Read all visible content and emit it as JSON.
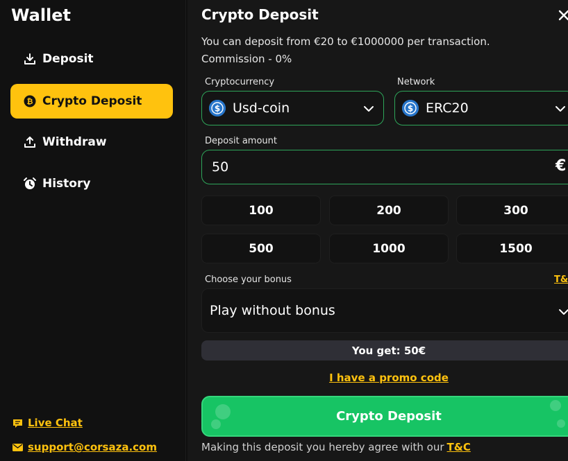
{
  "sidebar": {
    "title": "Wallet",
    "items": [
      {
        "label": "Deposit",
        "icon": "download-icon",
        "active": false
      },
      {
        "label": "Crypto Deposit",
        "icon": "bitcoin-icon",
        "active": true
      },
      {
        "label": "Withdraw",
        "icon": "upload-icon",
        "active": false
      },
      {
        "label": "History",
        "icon": "alarm-clock-icon",
        "active": false
      }
    ],
    "footer": {
      "live_chat": "Live Chat",
      "email": "support@corsaza.com"
    }
  },
  "main": {
    "title": "Crypto Deposit",
    "info_line1": "You can deposit from €20 to €1000000 per transaction.",
    "info_line2": "Commission - 0%",
    "crypto_label": "Cryptocurrency",
    "crypto_value": "Usd-coin",
    "network_label": "Network",
    "network_value": "ERC20",
    "amount_label": "Deposit amount",
    "amount_value": "50",
    "currency_symbol": "€",
    "presets": [
      "100",
      "200",
      "300",
      "500",
      "1000",
      "1500"
    ],
    "bonus_label": "Choose your bonus",
    "tc_short": "T&C",
    "bonus_value": "Play without bonus",
    "you_get": "You get: 50€",
    "promo_link": "I have a promo code",
    "deposit_button": "Crypto Deposit",
    "agree_text": "Making this deposit you hereby agree with our",
    "agree_link": "T&C"
  },
  "colors": {
    "accent": "#ffc20e",
    "button_green": "#17c464",
    "border_green": "#2ea65a",
    "coin_blue": "#2775ca"
  }
}
